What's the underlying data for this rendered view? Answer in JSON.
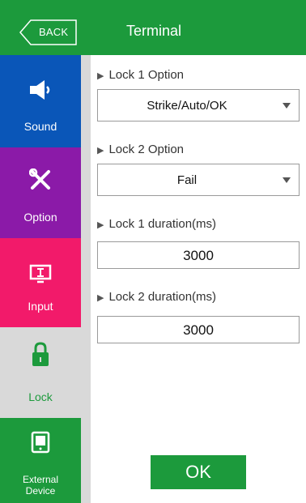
{
  "header": {
    "back_label": "BACK",
    "title": "Terminal"
  },
  "sidebar": {
    "items": [
      {
        "label": "Sound",
        "icon": "speaker-icon",
        "color": "#0a56b8"
      },
      {
        "label": "Option",
        "icon": "tools-icon",
        "color": "#8b1aa8"
      },
      {
        "label": "Input",
        "icon": "input-monitor-icon",
        "color": "#f21a6a"
      },
      {
        "label": "Lock",
        "icon": "lock-icon",
        "color": "#d9d9d9",
        "selected": true
      },
      {
        "label_line1": "External",
        "label_line2": "Device",
        "icon": "tablet-icon",
        "color": "#1c9a3c"
      }
    ]
  },
  "form": {
    "lock1_option_label": "Lock 1 Option",
    "lock1_option_value": "Strike/Auto/OK",
    "lock2_option_label": "Lock 2 Option",
    "lock2_option_value": "Fail",
    "lock1_duration_label": "Lock 1 duration(ms)",
    "lock1_duration_value": "3000",
    "lock2_duration_label": "Lock 2 duration(ms)",
    "lock2_duration_value": "3000"
  },
  "footer": {
    "ok_label": "OK"
  },
  "colors": {
    "accent_green": "#1c9a3c",
    "sound_blue": "#0a56b8",
    "option_purple": "#8b1aa8",
    "input_pink": "#f21a6a",
    "sidebar_gray": "#d9d9d9"
  }
}
